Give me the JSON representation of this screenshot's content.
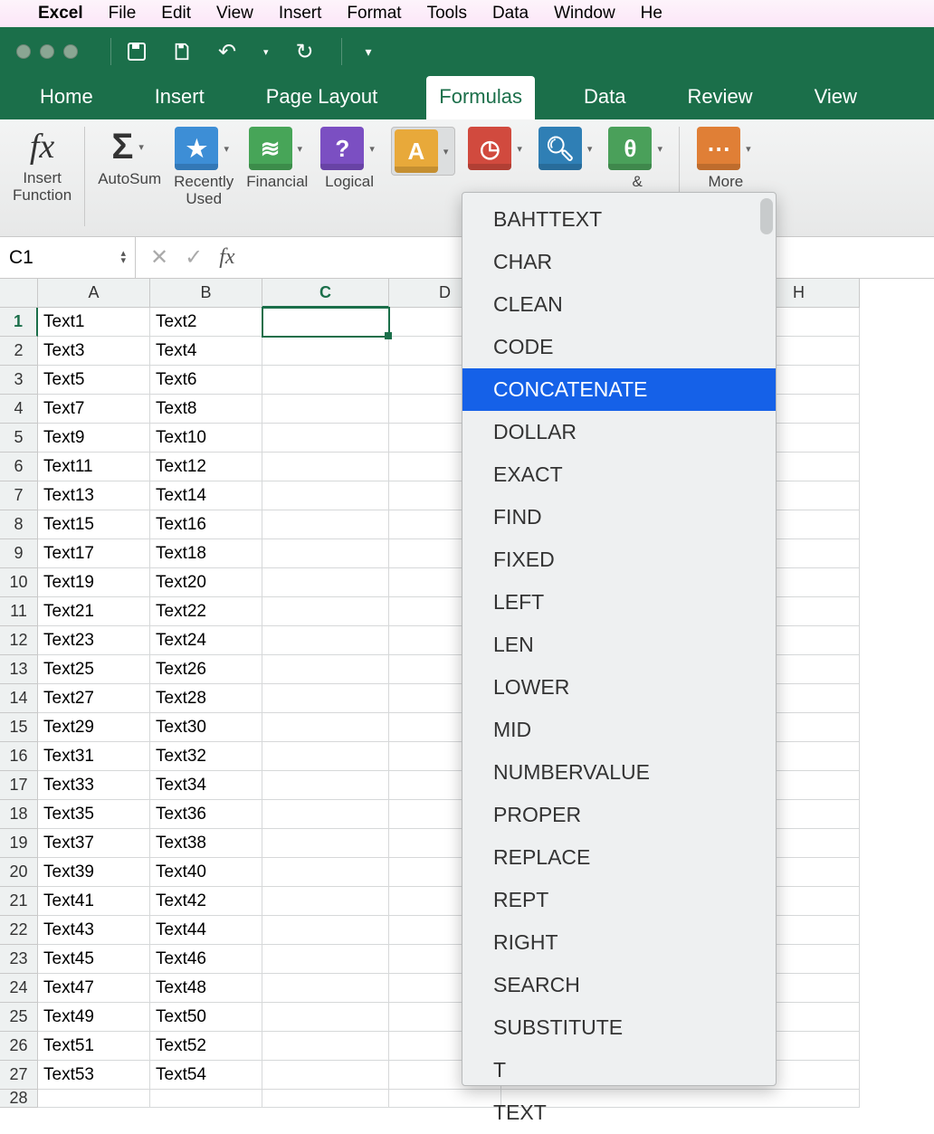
{
  "mac_menu": {
    "app": "Excel",
    "items": [
      "File",
      "Edit",
      "View",
      "Insert",
      "Format",
      "Tools",
      "Data",
      "Window",
      "He"
    ]
  },
  "ribbon": {
    "tabs": [
      "Home",
      "Insert",
      "Page Layout",
      "Formulas",
      "Data",
      "Review",
      "View"
    ],
    "active_tab": "Formulas",
    "groups": {
      "insert_function": "Insert\nFunction",
      "autosum": "AutoSum",
      "recently_used": "Recently\nUsed",
      "financial": "Financial",
      "logical": "Logical",
      "trig_tail": "&\ng",
      "more_functions": "More\nFunctions"
    }
  },
  "formula_bar": {
    "namebox": "C1",
    "formula": ""
  },
  "columns": [
    "A",
    "B",
    "C",
    "D"
  ],
  "extra_col": "H",
  "rows": [
    {
      "n": 1,
      "a": "Text1",
      "b": "Text2"
    },
    {
      "n": 2,
      "a": "Text3",
      "b": "Text4"
    },
    {
      "n": 3,
      "a": "Text5",
      "b": "Text6"
    },
    {
      "n": 4,
      "a": "Text7",
      "b": "Text8"
    },
    {
      "n": 5,
      "a": "Text9",
      "b": "Text10"
    },
    {
      "n": 6,
      "a": "Text11",
      "b": "Text12"
    },
    {
      "n": 7,
      "a": "Text13",
      "b": "Text14"
    },
    {
      "n": 8,
      "a": "Text15",
      "b": "Text16"
    },
    {
      "n": 9,
      "a": "Text17",
      "b": "Text18"
    },
    {
      "n": 10,
      "a": "Text19",
      "b": "Text20"
    },
    {
      "n": 11,
      "a": "Text21",
      "b": "Text22"
    },
    {
      "n": 12,
      "a": "Text23",
      "b": "Text24"
    },
    {
      "n": 13,
      "a": "Text25",
      "b": "Text26"
    },
    {
      "n": 14,
      "a": "Text27",
      "b": "Text28"
    },
    {
      "n": 15,
      "a": "Text29",
      "b": "Text30"
    },
    {
      "n": 16,
      "a": "Text31",
      "b": "Text32"
    },
    {
      "n": 17,
      "a": "Text33",
      "b": "Text34"
    },
    {
      "n": 18,
      "a": "Text35",
      "b": "Text36"
    },
    {
      "n": 19,
      "a": "Text37",
      "b": "Text38"
    },
    {
      "n": 20,
      "a": "Text39",
      "b": "Text40"
    },
    {
      "n": 21,
      "a": "Text41",
      "b": "Text42"
    },
    {
      "n": 22,
      "a": "Text43",
      "b": "Text44"
    },
    {
      "n": 23,
      "a": "Text45",
      "b": "Text46"
    },
    {
      "n": 24,
      "a": "Text47",
      "b": "Text48"
    },
    {
      "n": 25,
      "a": "Text49",
      "b": "Text50"
    },
    {
      "n": 26,
      "a": "Text51",
      "b": "Text52"
    },
    {
      "n": 27,
      "a": "Text53",
      "b": "Text54"
    }
  ],
  "last_row_num": "28",
  "dropdown": {
    "items": [
      "BAHTTEXT",
      "CHAR",
      "CLEAN",
      "CODE",
      "CONCATENATE",
      "DOLLAR",
      "EXACT",
      "FIND",
      "FIXED",
      "LEFT",
      "LEN",
      "LOWER",
      "MID",
      "NUMBERVALUE",
      "PROPER",
      "REPLACE",
      "REPT",
      "RIGHT",
      "SEARCH",
      "SUBSTITUTE",
      "T",
      "TEXT"
    ],
    "highlighted": "CONCATENATE"
  }
}
